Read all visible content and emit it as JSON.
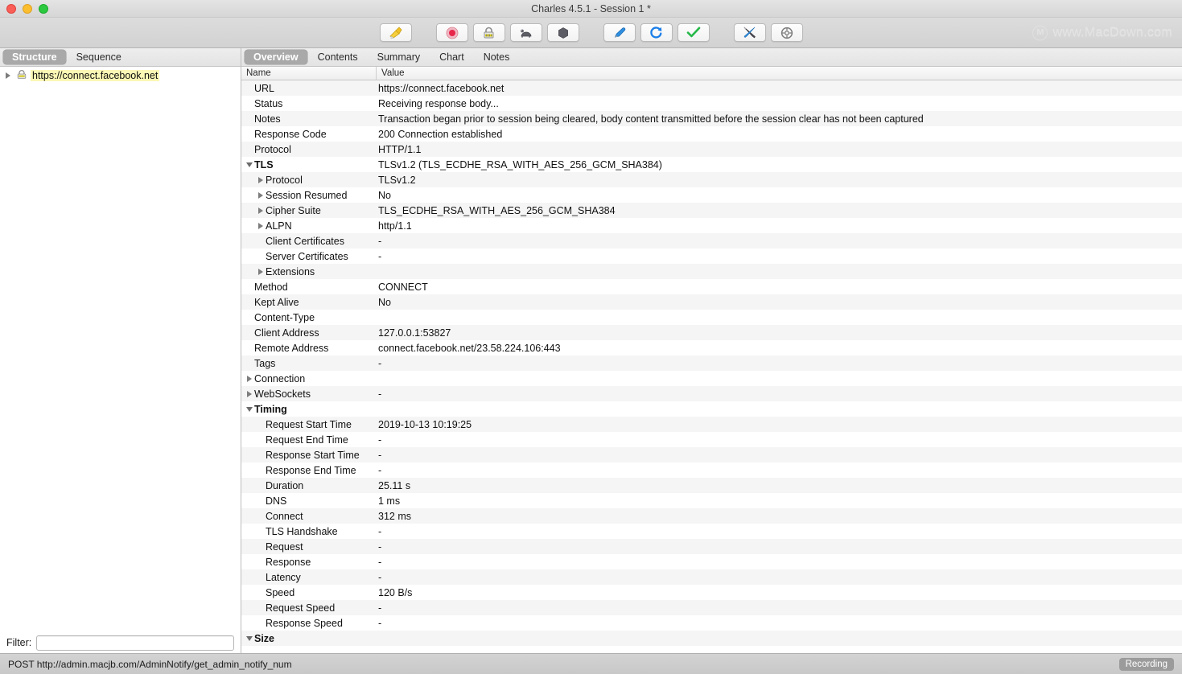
{
  "window": {
    "title": "Charles 4.5.1 - Session 1 *",
    "traffic_lights": [
      "close",
      "minimize",
      "zoom"
    ]
  },
  "watermark": {
    "logo": "macdown-logo-icon",
    "text": "www.MacDown.com"
  },
  "toolbar": {
    "groups": [
      {
        "buttons": [
          {
            "name": "clear-session-button",
            "icon": "broom-icon"
          }
        ]
      },
      {
        "buttons": [
          {
            "name": "record-button",
            "icon": "record-circle-icon"
          },
          {
            "name": "ssl-proxying-button",
            "icon": "padlock-icon"
          },
          {
            "name": "throttle-button",
            "icon": "tortoise-icon"
          },
          {
            "name": "breakpoints-button",
            "icon": "hexagon-icon"
          }
        ]
      },
      {
        "buttons": [
          {
            "name": "compose-button",
            "icon": "pen-icon"
          },
          {
            "name": "repeat-button",
            "icon": "refresh-icon"
          },
          {
            "name": "validate-button",
            "icon": "checkmark-icon"
          }
        ]
      },
      {
        "buttons": [
          {
            "name": "tools-button",
            "icon": "tools-icon"
          },
          {
            "name": "settings-button",
            "icon": "gear-icon"
          }
        ]
      }
    ]
  },
  "left_pane": {
    "tabs": [
      {
        "label": "Structure",
        "active": true
      },
      {
        "label": "Sequence",
        "active": false
      }
    ],
    "tree": [
      {
        "label": "https://connect.facebook.net",
        "icon": "lock-icon",
        "expanded": false,
        "highlighted": true
      }
    ],
    "filter": {
      "label": "Filter:",
      "value": "",
      "placeholder": ""
    }
  },
  "right_pane": {
    "tabs": [
      {
        "label": "Overview",
        "active": true
      },
      {
        "label": "Contents",
        "active": false
      },
      {
        "label": "Summary",
        "active": false
      },
      {
        "label": "Chart",
        "active": false
      },
      {
        "label": "Notes",
        "active": false
      }
    ],
    "columns": {
      "name": "Name",
      "value": "Value"
    },
    "rows": [
      {
        "indent": 0,
        "disclosure": "none",
        "name": "URL",
        "value": "https://connect.facebook.net",
        "group": false
      },
      {
        "indent": 0,
        "disclosure": "none",
        "name": "Status",
        "value": "Receiving response body...",
        "group": false
      },
      {
        "indent": 0,
        "disclosure": "none",
        "name": "Notes",
        "value": "Transaction began prior to session being cleared, body content transmitted before the session clear has not been captured",
        "group": false
      },
      {
        "indent": 0,
        "disclosure": "none",
        "name": "Response Code",
        "value": "200 Connection established",
        "group": false
      },
      {
        "indent": 0,
        "disclosure": "none",
        "name": "Protocol",
        "value": "HTTP/1.1",
        "group": false
      },
      {
        "indent": 0,
        "disclosure": "open",
        "name": "TLS",
        "value": "TLSv1.2 (TLS_ECDHE_RSA_WITH_AES_256_GCM_SHA384)",
        "group": true
      },
      {
        "indent": 1,
        "disclosure": "closed",
        "name": "Protocol",
        "value": "TLSv1.2",
        "group": false
      },
      {
        "indent": 1,
        "disclosure": "closed",
        "name": "Session Resumed",
        "value": "No",
        "group": false
      },
      {
        "indent": 1,
        "disclosure": "closed",
        "name": "Cipher Suite",
        "value": "TLS_ECDHE_RSA_WITH_AES_256_GCM_SHA384",
        "group": false
      },
      {
        "indent": 1,
        "disclosure": "closed",
        "name": "ALPN",
        "value": "http/1.1",
        "group": false
      },
      {
        "indent": 1,
        "disclosure": "none",
        "name": "Client Certificates",
        "value": "-",
        "group": false
      },
      {
        "indent": 1,
        "disclosure": "none",
        "name": "Server Certificates",
        "value": "-",
        "group": false
      },
      {
        "indent": 1,
        "disclosure": "closed",
        "name": "Extensions",
        "value": "",
        "group": false
      },
      {
        "indent": 0,
        "disclosure": "none",
        "name": "Method",
        "value": "CONNECT",
        "group": false
      },
      {
        "indent": 0,
        "disclosure": "none",
        "name": "Kept Alive",
        "value": "No",
        "group": false
      },
      {
        "indent": 0,
        "disclosure": "none",
        "name": "Content-Type",
        "value": "",
        "group": false
      },
      {
        "indent": 0,
        "disclosure": "none",
        "name": "Client Address",
        "value": "127.0.0.1:53827",
        "group": false
      },
      {
        "indent": 0,
        "disclosure": "none",
        "name": "Remote Address",
        "value": "connect.facebook.net/23.58.224.106:443",
        "group": false
      },
      {
        "indent": 0,
        "disclosure": "none",
        "name": "Tags",
        "value": "-",
        "group": false
      },
      {
        "indent": 0,
        "disclosure": "closed",
        "name": "Connection",
        "value": "",
        "group": false
      },
      {
        "indent": 0,
        "disclosure": "closed",
        "name": "WebSockets",
        "value": "-",
        "group": false
      },
      {
        "indent": 0,
        "disclosure": "open",
        "name": "Timing",
        "value": "",
        "group": true
      },
      {
        "indent": 1,
        "disclosure": "none",
        "name": "Request Start Time",
        "value": "2019-10-13 10:19:25",
        "group": false
      },
      {
        "indent": 1,
        "disclosure": "none",
        "name": "Request End Time",
        "value": "-",
        "group": false
      },
      {
        "indent": 1,
        "disclosure": "none",
        "name": "Response Start Time",
        "value": "-",
        "group": false
      },
      {
        "indent": 1,
        "disclosure": "none",
        "name": "Response End Time",
        "value": "-",
        "group": false
      },
      {
        "indent": 1,
        "disclosure": "none",
        "name": "Duration",
        "value": "25.11 s",
        "group": false
      },
      {
        "indent": 1,
        "disclosure": "none",
        "name": "DNS",
        "value": "1 ms",
        "group": false
      },
      {
        "indent": 1,
        "disclosure": "none",
        "name": "Connect",
        "value": "312 ms",
        "group": false
      },
      {
        "indent": 1,
        "disclosure": "none",
        "name": "TLS Handshake",
        "value": "-",
        "group": false
      },
      {
        "indent": 1,
        "disclosure": "none",
        "name": "Request",
        "value": "-",
        "group": false
      },
      {
        "indent": 1,
        "disclosure": "none",
        "name": "Response",
        "value": "-",
        "group": false
      },
      {
        "indent": 1,
        "disclosure": "none",
        "name": "Latency",
        "value": "-",
        "group": false
      },
      {
        "indent": 1,
        "disclosure": "none",
        "name": "Speed",
        "value": "120 B/s",
        "group": false
      },
      {
        "indent": 1,
        "disclosure": "none",
        "name": "Request Speed",
        "value": "-",
        "group": false
      },
      {
        "indent": 1,
        "disclosure": "none",
        "name": "Response Speed",
        "value": "-",
        "group": false
      },
      {
        "indent": 0,
        "disclosure": "open",
        "name": "Size",
        "value": "",
        "group": true
      }
    ]
  },
  "statusbar": {
    "text": "POST http://admin.macjb.com/AdminNotify/get_admin_notify_num",
    "recording_label": "Recording"
  },
  "colors": {
    "highlight_yellow": "#fbf7b5",
    "tab_active_bg": "#a9a9a9",
    "row_alt": "#f5f5f5",
    "record_red": "#e8264a",
    "refresh_blue": "#1a7ee8",
    "check_green": "#27b84a",
    "broom_yellow": "#f2c225",
    "recording_badge_bg": "#9b9b9b"
  }
}
